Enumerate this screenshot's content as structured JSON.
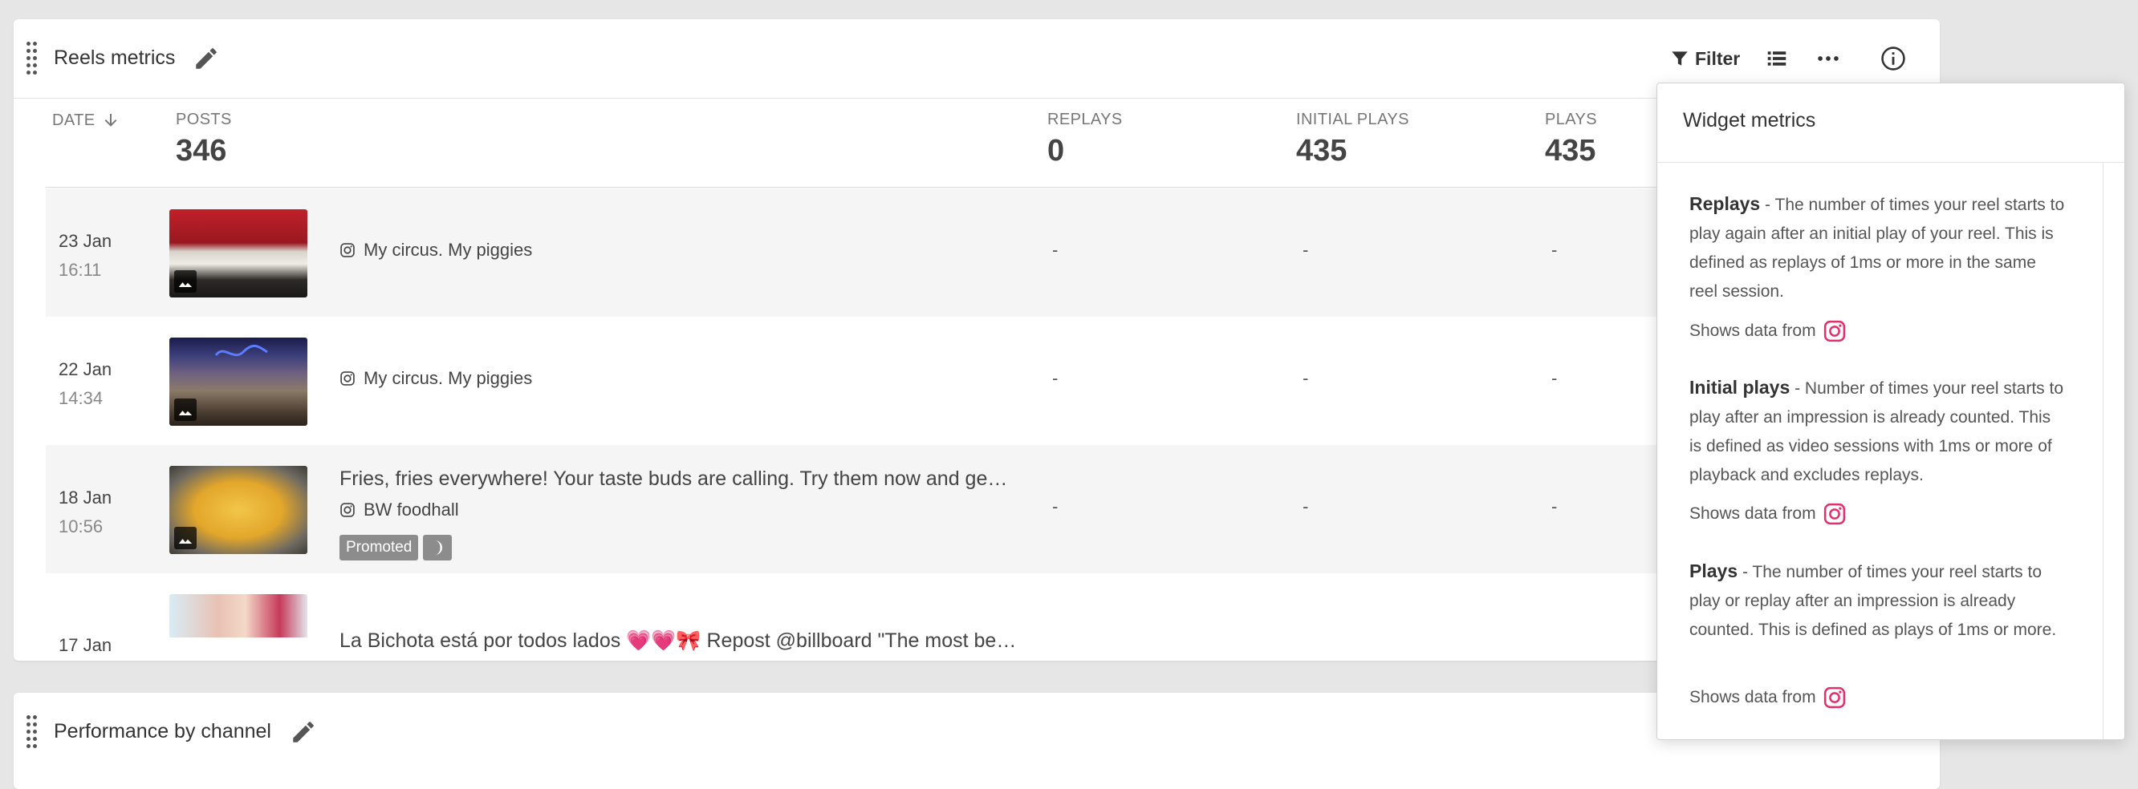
{
  "widget1": {
    "title": "Reels metrics",
    "filter_label": "Filter",
    "columns": {
      "date": "DATE",
      "posts": "POSTS",
      "posts_total": "346",
      "replays": "REPLAYS",
      "replays_total": "0",
      "initial_plays": "INITIAL PLAYS",
      "initial_plays_total": "435",
      "plays": "PLAYS",
      "plays_total": "435"
    },
    "rows": [
      {
        "date": "23 Jan",
        "time": "16:11",
        "caption": "",
        "channel": "My circus. My piggies",
        "replays": "-",
        "initial_plays": "-",
        "plays": "-"
      },
      {
        "date": "22 Jan",
        "time": "14:34",
        "caption": "",
        "channel": "My circus. My piggies",
        "replays": "-",
        "initial_plays": "-",
        "plays": "-"
      },
      {
        "date": "18 Jan",
        "time": "10:56",
        "caption": "Fries, fries everywhere! Your taste buds are calling. Try them now and ge…",
        "channel": "BW foodhall",
        "badge": "Promoted",
        "replays": "-",
        "initial_plays": "-",
        "plays": "-"
      },
      {
        "date": "17 Jan",
        "time": "",
        "caption": "La Bichota está por todos lados 💗💗🎀 Repost @billboard \"The most be…",
        "channel": ""
      }
    ]
  },
  "widget2": {
    "title": "Performance by channel"
  },
  "popover": {
    "title": "Widget metrics",
    "metrics": [
      {
        "name": "Replays",
        "description": " - The number of times your reel starts to play again after an initial play of your reel. This is defined as replays of 1ms or more in the same reel session.",
        "shows": "Shows data from"
      },
      {
        "name": "Initial plays",
        "description": " - Number of times your reel starts to play after an impression is already counted. This is defined as video sessions with 1ms or more of playback and excludes replays.",
        "shows": "Shows data from"
      },
      {
        "name": "Plays",
        "description": " - The number of times your reel starts to play or replay after an impression is already counted. This is defined as plays of 1ms or more.",
        "shows": "Shows data from"
      }
    ]
  },
  "icons": {
    "drag": "drag-handle-icon",
    "edit": "pencil-icon",
    "filter": "filter-icon",
    "list": "list-view-icon",
    "more": "more-horizontal-icon",
    "info": "info-icon",
    "sort": "arrow-down-icon",
    "instagram": "instagram-icon",
    "image": "image-icon",
    "moon": "moon-icon"
  },
  "colors": {
    "instagram": "#e1306c",
    "badge": "#8c8c8c"
  }
}
